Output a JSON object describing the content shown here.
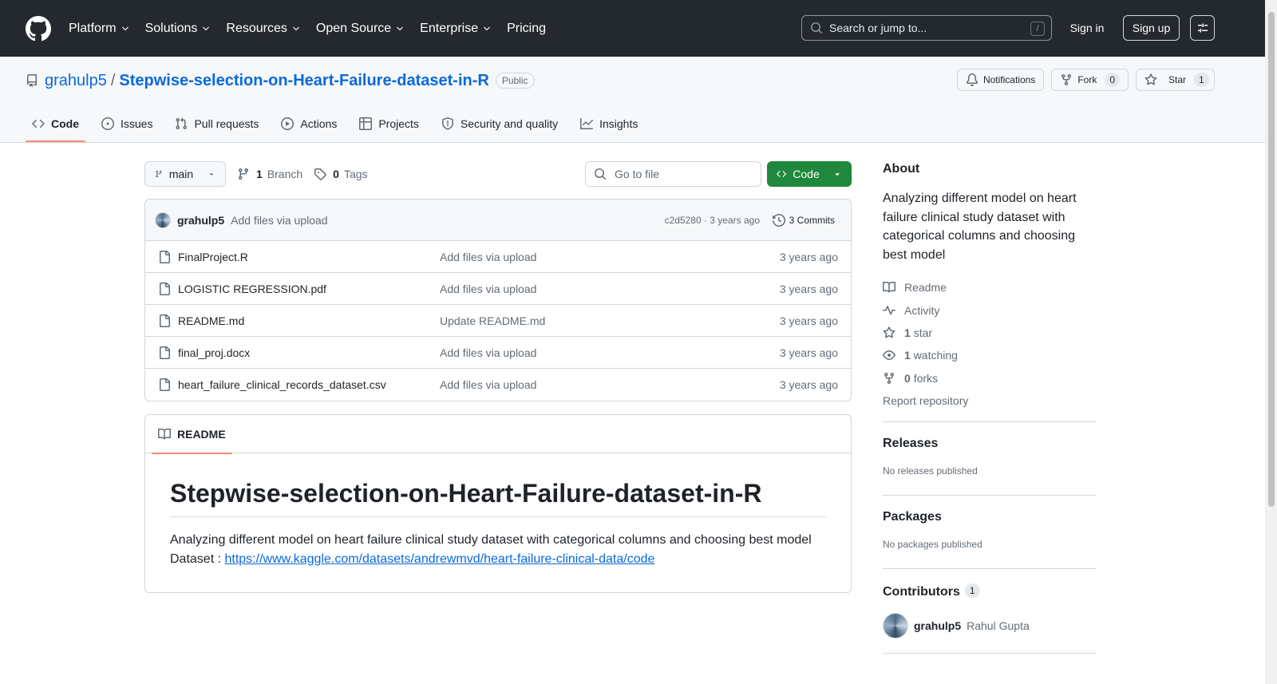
{
  "header": {
    "nav": [
      "Platform",
      "Solutions",
      "Resources",
      "Open Source",
      "Enterprise",
      "Pricing"
    ],
    "search_placeholder": "Search or jump to...",
    "search_shortcut": "/",
    "signin": "Sign in",
    "signup": "Sign up"
  },
  "repo": {
    "owner": "grahulp5",
    "separator": "/",
    "name": "Stepwise-selection-on-Heart-Failure-dataset-in-R",
    "visibility": "Public",
    "notifications_label": "Notifications",
    "fork_label": "Fork",
    "fork_count": "0",
    "star_label": "Star",
    "star_count": "1",
    "tabs": [
      "Code",
      "Issues",
      "Pull requests",
      "Actions",
      "Projects",
      "Security and quality",
      "Insights"
    ]
  },
  "toolbar": {
    "branch": "main",
    "branch_count": "1",
    "branch_label": "Branch",
    "tag_count": "0",
    "tag_label": "Tags",
    "goto_placeholder": "Go to file",
    "code_label": "Code"
  },
  "latest_commit": {
    "author": "grahulp5",
    "message": "Add files via upload",
    "hash_age": "c2d5280 · 3 years ago",
    "commits_label": "3 Commits"
  },
  "files": [
    {
      "name": "FinalProject.R",
      "message": "Add files via upload",
      "age": "3 years ago"
    },
    {
      "name": "LOGISTIC REGRESSION.pdf",
      "message": "Add files via upload",
      "age": "3 years ago"
    },
    {
      "name": "README.md",
      "message": "Update README.md",
      "age": "3 years ago"
    },
    {
      "name": "final_proj.docx",
      "message": "Add files via upload",
      "age": "3 years ago"
    },
    {
      "name": "heart_failure_clinical_records_dataset.csv",
      "message": "Add files via upload",
      "age": "3 years ago"
    }
  ],
  "readme": {
    "tab_label": "README",
    "heading": "Stepwise-selection-on-Heart-Failure-dataset-in-R",
    "description": "Analyzing different model on heart failure clinical study dataset with categorical columns and choosing best model",
    "dataset_prefix": "Dataset : ",
    "dataset_url": "https://www.kaggle.com/datasets/andrewmvd/heart-failure-clinical-data/code"
  },
  "about": {
    "title": "About",
    "description": "Analyzing different model on heart failure clinical study dataset with categorical columns and choosing best model",
    "readme": "Readme",
    "activity": "Activity",
    "stars_count": "1",
    "stars_label": "star",
    "watching_count": "1",
    "watching_label": "watching",
    "forks_count": "0",
    "forks_label": "forks",
    "report": "Report repository"
  },
  "releases": {
    "title": "Releases",
    "empty": "No releases published"
  },
  "packages": {
    "title": "Packages",
    "empty": "No packages published"
  },
  "contributors": {
    "title": "Contributors",
    "count": "1",
    "login": "grahulp5",
    "name": "Rahul Gupta"
  },
  "colors": {
    "header_bg": "#24292f",
    "link": "#0969da",
    "primary_button": "#1f883d",
    "active_tab_underline": "#fd8c73"
  }
}
